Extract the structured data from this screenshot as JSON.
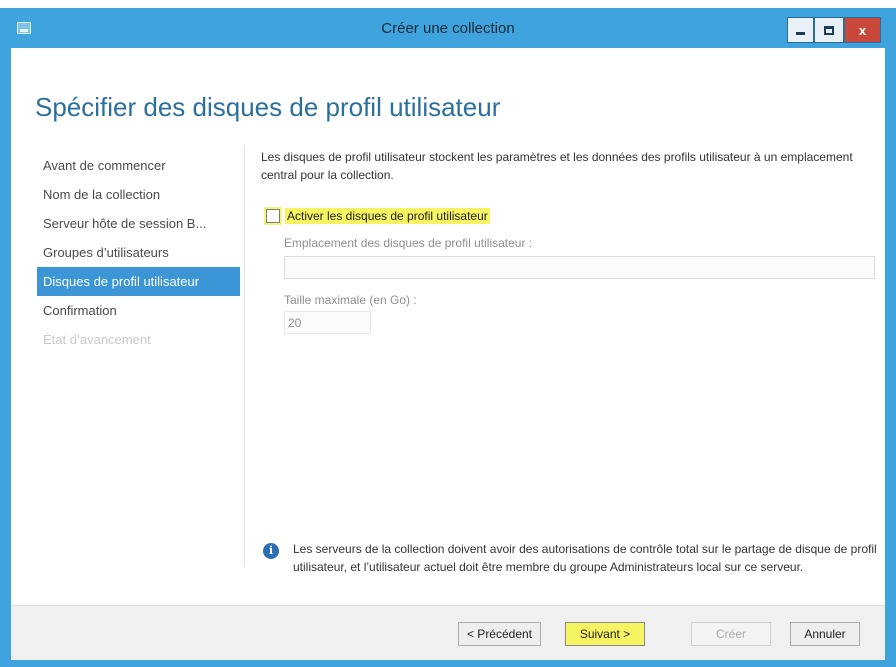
{
  "window": {
    "title": "Créer une collection",
    "controls": {
      "minimize": "minimize",
      "maximize": "maximize",
      "close": "x"
    }
  },
  "page": {
    "heading": "Spécifier des disques de profil utilisateur"
  },
  "nav": {
    "items": [
      {
        "label": "Avant de commencer",
        "state": "normal"
      },
      {
        "label": "Nom de la collection",
        "state": "normal"
      },
      {
        "label": "Serveur hôte de session B...",
        "state": "normal"
      },
      {
        "label": "Groupes d’utilisateurs",
        "state": "normal"
      },
      {
        "label": "Disques de profil utilisateur",
        "state": "active"
      },
      {
        "label": "Confirmation",
        "state": "normal"
      },
      {
        "label": "État d’avancement",
        "state": "disabled"
      }
    ]
  },
  "content": {
    "description": "Les disques de profil utilisateur stockent les paramètres et les données des profils utilisateur à un emplacement central pour la collection.",
    "enable_checkbox_label": "Activer les disques de profil utilisateur",
    "enable_checked": false,
    "location_label": "Emplacement des disques de profil utilisateur :",
    "location_value": "",
    "max_size_label": "Taille maximale (en Go) :",
    "max_size_value": "20"
  },
  "info": {
    "icon": "info-icon",
    "text": "Les serveurs de la collection doivent avoir des autorisations de contrôle total sur le partage de disque de profil utilisateur, et l’utilisateur actuel doit être membre du groupe Administrateurs local sur ce serveur."
  },
  "footer": {
    "previous": "< Précédent",
    "next": "Suivant >",
    "create": "Créer",
    "cancel": "Annuler"
  },
  "colors": {
    "frame": "#3fa3de",
    "heading": "#2c6f9c",
    "nav_active": "#3c96d6",
    "highlight": "#f7f463"
  }
}
